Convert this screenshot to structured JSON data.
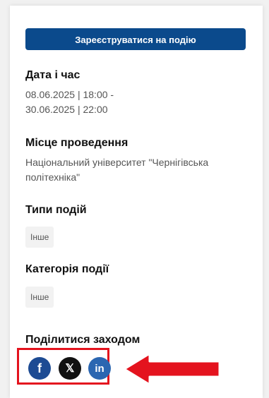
{
  "register_button": "Зареєструватися на подію",
  "date": {
    "title": "Дата і час",
    "line1": "08.06.2025 | 18:00 -",
    "line2": "30.06.2025 | 22:00"
  },
  "venue": {
    "title": "Місце проведення",
    "line1": "Національний університет \"Чернігівська",
    "line2": "політехніка\""
  },
  "event_types": {
    "title": "Типи подій",
    "tag": "Інше"
  },
  "event_category": {
    "title": "Категорія події",
    "tag": "Інше"
  },
  "share": {
    "title": "Поділитися заходом",
    "icons": [
      "facebook-icon",
      "x-icon",
      "linkedin-icon"
    ],
    "facebook_glyph": "f",
    "x_glyph": "𝕏",
    "linkedin_glyph": "in"
  },
  "colors": {
    "accent": "#0b4a8c",
    "annotation": "#e4131e"
  }
}
